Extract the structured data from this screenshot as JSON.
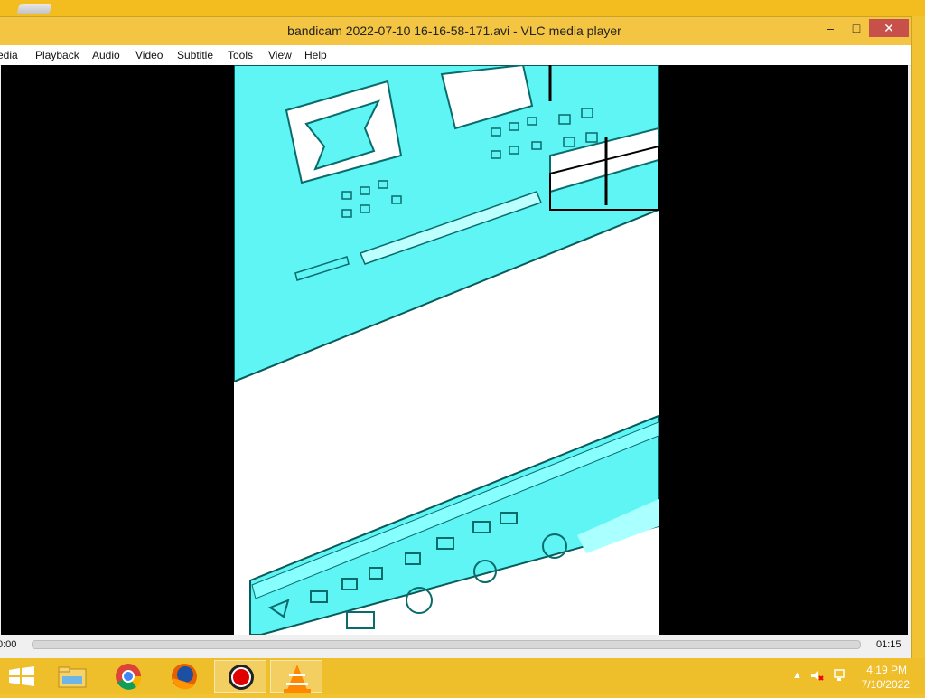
{
  "window": {
    "title": "bandicam 2022-07-10 16-16-58-171.avi - VLC media player",
    "minimize_label": "–",
    "maximize_label": "□",
    "close_label": "✕"
  },
  "menu": {
    "items": [
      "edia",
      "Playback",
      "Audio",
      "Video",
      "Subtitle",
      "Tools",
      "View",
      "Help"
    ]
  },
  "player": {
    "elapsed": "0:00",
    "duration": "01:15",
    "progress": 0.0
  },
  "taskbar": {
    "apps": [
      "windows-start-icon",
      "file-explorer-icon",
      "chrome-icon",
      "firefox-icon",
      "bandicam-record-icon",
      "vlc-icon"
    ],
    "clock_time": "4:19 PM",
    "clock_date": "7/10/2022"
  },
  "colors": {
    "accent": "#f4c542",
    "frame_cyan": "#5ff5f5",
    "close": "#c7504a"
  }
}
